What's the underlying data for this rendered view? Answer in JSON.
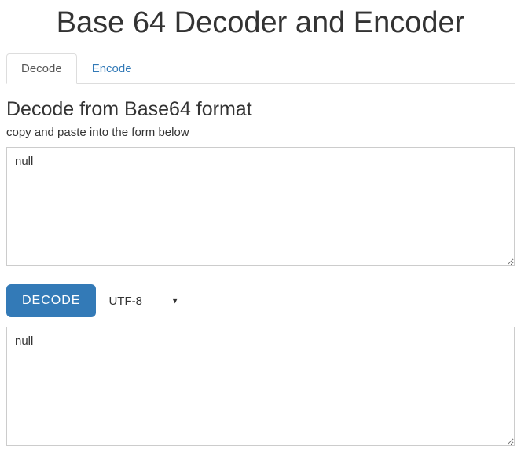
{
  "title": "Base 64 Decoder and Encoder",
  "tabs": {
    "decode": "Decode",
    "encode": "Encode"
  },
  "section_heading": "Decode from Base64 format",
  "hint": "copy and paste into the form below",
  "input_value": "null",
  "decode_button": "DECODE",
  "encoding_selected": "UTF-8",
  "output_value": "null"
}
